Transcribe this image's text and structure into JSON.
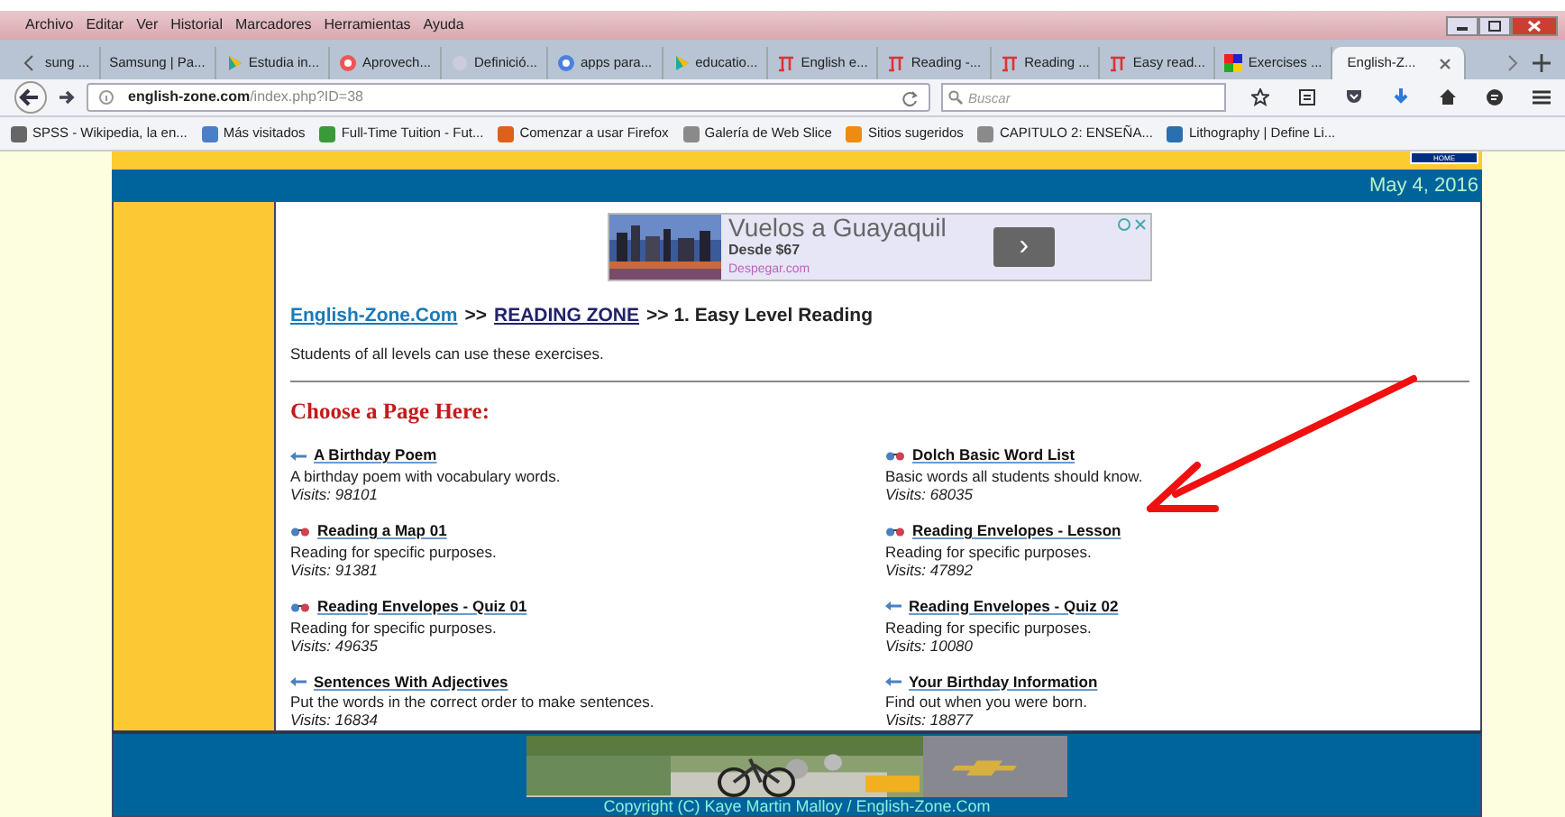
{
  "menu": [
    "Archivo",
    "Editar",
    "Ver",
    "Historial",
    "Marcadores",
    "Herramientas",
    "Ayuda"
  ],
  "tabs": [
    {
      "label": "sung ...",
      "kind": "plain",
      "selected": false
    },
    {
      "label": "Samsung | Pa...",
      "kind": "plain",
      "selected": false
    },
    {
      "label": "Estudia in...",
      "kind": "play",
      "selected": false
    },
    {
      "label": "Aprovech...",
      "kind": "target",
      "selected": false
    },
    {
      "label": "Definició...",
      "kind": "faint",
      "selected": false
    },
    {
      "label": "apps para...",
      "kind": "google",
      "selected": false
    },
    {
      "label": "educatio...",
      "kind": "play",
      "selected": false
    },
    {
      "label": "English e...",
      "kind": "ez",
      "selected": false
    },
    {
      "label": "Reading -...",
      "kind": "ez",
      "selected": false
    },
    {
      "label": "Reading ...",
      "kind": "ez",
      "selected": false
    },
    {
      "label": "Easy read...",
      "kind": "ez",
      "selected": false
    },
    {
      "label": "Exercises ...",
      "kind": "squares",
      "selected": false
    },
    {
      "label": "English-Z...",
      "kind": "plain",
      "selected": true
    }
  ],
  "address": {
    "host": "english-zone.com",
    "path": "/index.php?ID=38"
  },
  "search": {
    "placeholder": "Buscar"
  },
  "bookmarks": [
    {
      "label": "SPSS - Wikipedia, la en...",
      "color": "#666666"
    },
    {
      "label": "Más visitados",
      "color": "#4a7fc8"
    },
    {
      "label": "Full-Time Tuition - Fut...",
      "color": "#3a9a3a"
    },
    {
      "label": "Comenzar a usar Firefox",
      "color": "#e0601a"
    },
    {
      "label": "Galería de Web Slice",
      "color": "#8a8a8a"
    },
    {
      "label": "Sitios sugeridos",
      "color": "#f08a10"
    },
    {
      "label": "CAPITULO 2: ENSEÑA...",
      "color": "#8a8a8a"
    },
    {
      "label": "Lithography | Define Li...",
      "color": "#2a70b0"
    }
  ],
  "page": {
    "home_button": "HOME",
    "date": "May 4, 2016",
    "ad": {
      "headline": "Vuelos a Guayaquil",
      "price": "Desde $67",
      "source": "Despegar.com",
      "button": "›"
    },
    "breadcrumb": [
      {
        "text": "English-Zone.Com",
        "kind": "home"
      },
      {
        "text": ">>",
        "kind": "sep"
      },
      {
        "text": "READING ZONE",
        "kind": "section"
      },
      {
        "text": ">> 1. Easy Level Reading",
        "kind": "sep"
      }
    ],
    "intro": "Students of all levels can use these exercises.",
    "heading": "Choose a Page Here:",
    "items": [
      {
        "kind": "arrow",
        "title": "A Birthday Poem",
        "description": "A birthday poem with vocabulary words.",
        "visits": "Visits: 98101"
      },
      {
        "kind": "glasses",
        "title": "Dolch Basic Word List",
        "description": "Basic words all students should know.",
        "visits": "Visits: 68035"
      },
      {
        "kind": "glasses",
        "title": "Reading a Map 01",
        "description": "Reading for specific purposes.",
        "visits": "Visits: 91381"
      },
      {
        "kind": "glasses",
        "title": "Reading Envelopes - Lesson",
        "description": "Reading for specific purposes.",
        "visits": "Visits: 47892"
      },
      {
        "kind": "glasses",
        "title": "Reading Envelopes - Quiz 01",
        "description": "Reading for specific purposes.",
        "visits": "Visits: 49635"
      },
      {
        "kind": "arrow",
        "title": "Reading Envelopes - Quiz 02",
        "description": "Reading for specific purposes.",
        "visits": "Visits: 10080"
      },
      {
        "kind": "arrow",
        "title": "Sentences With Adjectives",
        "description": "Put the words in the correct order to make sentences.",
        "visits": "Visits: 16834"
      },
      {
        "kind": "arrow",
        "title": "Your Birthday Information",
        "description": "Find out when you were born.",
        "visits": "Visits: 18877"
      }
    ],
    "annotations": [
      {
        "kind": "arrow"
      }
    ],
    "footer": {
      "copyright": "Copyright (C) Kaye Martin Malloy / English-Zone.Com"
    }
  }
}
